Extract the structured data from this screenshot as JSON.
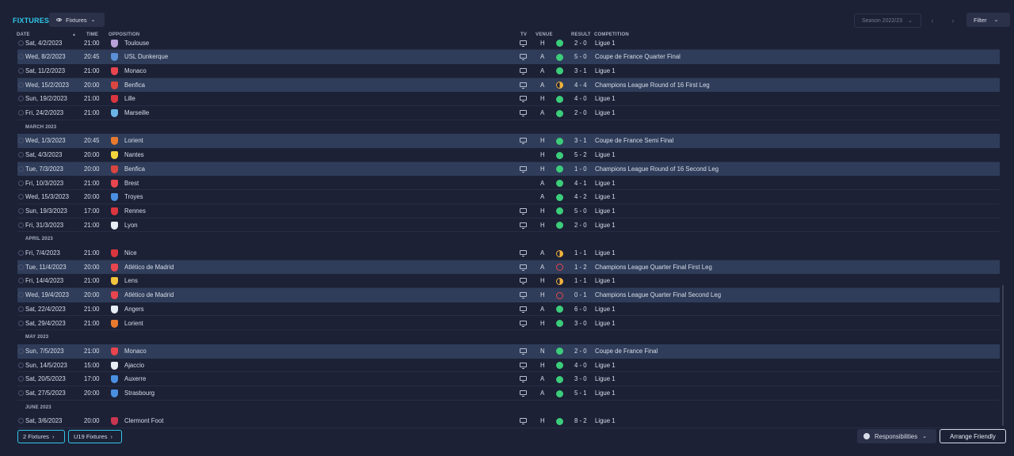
{
  "header": {
    "title": "FIXTURES",
    "view_label": "Fixtures",
    "season_label": "Season 2022/23",
    "filter_label": "Filter"
  },
  "columns": {
    "date": "DATE",
    "time": "TIME",
    "opposition": "OPPOSITION",
    "tv": "TV",
    "venue": "VENUE",
    "result": "RESULT",
    "competition": "COMPETITION"
  },
  "rows": [
    {
      "kind": "match",
      "date": "Sat, 4/2/2023",
      "time": "21:00",
      "opp": "Toulouse",
      "badge": "#b8a0d8",
      "tv": true,
      "venue": "H",
      "outcome": "win",
      "score": "2 - 0",
      "comp": "Ligue 1",
      "alt": false
    },
    {
      "kind": "match",
      "date": "Wed, 8/2/2023",
      "time": "20:45",
      "opp": "USL Dunkerque",
      "badge": "#5b8fd6",
      "tv": true,
      "venue": "A",
      "outcome": "win",
      "score": "5 - 0",
      "comp": "Coupe de France Quarter Final",
      "alt": true
    },
    {
      "kind": "match",
      "date": "Sat, 11/2/2023",
      "time": "21:00",
      "opp": "Monaco",
      "badge": "#e8454f",
      "tv": true,
      "venue": "A",
      "outcome": "win",
      "score": "3 - 1",
      "comp": "Ligue 1",
      "alt": false
    },
    {
      "kind": "match",
      "date": "Wed, 15/2/2023",
      "time": "20:00",
      "opp": "Benfica",
      "badge": "#d9463f",
      "tv": true,
      "venue": "A",
      "outcome": "draw",
      "score": "4 - 4",
      "comp": "Champions League Round of 16  First Leg",
      "alt": true
    },
    {
      "kind": "match",
      "date": "Sun, 19/2/2023",
      "time": "21:00",
      "opp": "Lille",
      "badge": "#d9363f",
      "tv": true,
      "venue": "H",
      "outcome": "win",
      "score": "4 - 0",
      "comp": "Ligue 1",
      "alt": false
    },
    {
      "kind": "match",
      "date": "Fri, 24/2/2023",
      "time": "21:00",
      "opp": "Marseille",
      "badge": "#6ab4e6",
      "tv": true,
      "venue": "A",
      "outcome": "win",
      "score": "2 - 0",
      "comp": "Ligue 1",
      "alt": false
    },
    {
      "kind": "month",
      "label": "MARCH 2023"
    },
    {
      "kind": "match",
      "date": "Wed, 1/3/2023",
      "time": "20:45",
      "opp": "Lorient",
      "badge": "#e87a2f",
      "tv": true,
      "venue": "H",
      "outcome": "win",
      "score": "3 - 1",
      "comp": "Coupe de France Semi Final",
      "alt": true
    },
    {
      "kind": "match",
      "date": "Sat, 4/3/2023",
      "time": "20:00",
      "opp": "Nantes",
      "badge": "#f2d43d",
      "tv": false,
      "venue": "H",
      "outcome": "win",
      "score": "5 - 2",
      "comp": "Ligue 1",
      "alt": false
    },
    {
      "kind": "match",
      "date": "Tue, 7/3/2023",
      "time": "20:00",
      "opp": "Benfica",
      "badge": "#d9463f",
      "tv": true,
      "venue": "H",
      "outcome": "win",
      "score": "1 - 0",
      "comp": "Champions League Round of 16  Second Leg",
      "alt": true
    },
    {
      "kind": "match",
      "date": "Fri, 10/3/2023",
      "time": "21:00",
      "opp": "Brest",
      "badge": "#e8454f",
      "tv": false,
      "venue": "A",
      "outcome": "win",
      "score": "4 - 1",
      "comp": "Ligue 1",
      "alt": false
    },
    {
      "kind": "match",
      "date": "Wed, 15/3/2023",
      "time": "20:00",
      "opp": "Troyes",
      "badge": "#4a8fe0",
      "tv": false,
      "venue": "A",
      "outcome": "win",
      "score": "4 - 2",
      "comp": "Ligue 1",
      "alt": false
    },
    {
      "kind": "match",
      "date": "Sun, 19/3/2023",
      "time": "17:00",
      "opp": "Rennes",
      "badge": "#d9363f",
      "tv": true,
      "venue": "H",
      "outcome": "win",
      "score": "5 - 0",
      "comp": "Ligue 1",
      "alt": false
    },
    {
      "kind": "match",
      "date": "Fri, 31/3/2023",
      "time": "21:00",
      "opp": "Lyon",
      "badge": "#e8ecf4",
      "tv": true,
      "venue": "H",
      "outcome": "win",
      "score": "2 - 0",
      "comp": "Ligue 1",
      "alt": false
    },
    {
      "kind": "month",
      "label": "APRIL 2023"
    },
    {
      "kind": "match",
      "date": "Fri, 7/4/2023",
      "time": "21:00",
      "opp": "Nice",
      "badge": "#d9363f",
      "tv": true,
      "venue": "A",
      "outcome": "draw",
      "score": "1 - 1",
      "comp": "Ligue 1",
      "alt": false
    },
    {
      "kind": "match",
      "date": "Tue, 11/4/2023",
      "time": "20:00",
      "opp": "Atlético de Madrid",
      "badge": "#e8454f",
      "tv": true,
      "venue": "A",
      "outcome": "loss",
      "score": "1 - 2",
      "comp": "Champions League Quarter Final First Leg",
      "alt": true
    },
    {
      "kind": "match",
      "date": "Fri, 14/4/2023",
      "time": "21:00",
      "opp": "Lens",
      "badge": "#f2c33d",
      "tv": true,
      "venue": "H",
      "outcome": "draw",
      "score": "1 - 1",
      "comp": "Ligue 1",
      "alt": false
    },
    {
      "kind": "match",
      "date": "Wed, 19/4/2023",
      "time": "20:00",
      "opp": "Atlético de Madrid",
      "badge": "#e8454f",
      "tv": true,
      "venue": "H",
      "outcome": "loss",
      "score": "0 - 1",
      "comp": "Champions League Quarter Final Second Leg",
      "alt": true
    },
    {
      "kind": "match",
      "date": "Sat, 22/4/2023",
      "time": "21:00",
      "opp": "Angers",
      "badge": "#e8ecf4",
      "tv": true,
      "venue": "A",
      "outcome": "win",
      "score": "6 - 0",
      "comp": "Ligue 1",
      "alt": false
    },
    {
      "kind": "match",
      "date": "Sat, 29/4/2023",
      "time": "21:00",
      "opp": "Lorient",
      "badge": "#e87a2f",
      "tv": true,
      "venue": "H",
      "outcome": "win",
      "score": "3 - 0",
      "comp": "Ligue 1",
      "alt": false
    },
    {
      "kind": "month",
      "label": "MAY 2023"
    },
    {
      "kind": "match",
      "date": "Sun, 7/5/2023",
      "time": "21:00",
      "opp": "Monaco",
      "badge": "#e8454f",
      "tv": true,
      "venue": "N",
      "outcome": "win",
      "score": "2 - 0",
      "comp": "Coupe de France Final",
      "alt": true
    },
    {
      "kind": "match",
      "date": "Sun, 14/5/2023",
      "time": "15:00",
      "opp": "Ajaccio",
      "badge": "#e8ecf4",
      "tv": true,
      "venue": "H",
      "outcome": "win",
      "score": "4 - 0",
      "comp": "Ligue 1",
      "alt": false
    },
    {
      "kind": "match",
      "date": "Sat, 20/5/2023",
      "time": "17:00",
      "opp": "Auxerre",
      "badge": "#4a8fe0",
      "tv": true,
      "venue": "A",
      "outcome": "win",
      "score": "3 - 0",
      "comp": "Ligue 1",
      "alt": false
    },
    {
      "kind": "match",
      "date": "Sat, 27/5/2023",
      "time": "20:00",
      "opp": "Strasbourg",
      "badge": "#4a8fe0",
      "tv": true,
      "venue": "A",
      "outcome": "win",
      "score": "5 - 1",
      "comp": "Ligue 1",
      "alt": false
    },
    {
      "kind": "month",
      "label": "JUNE 2023"
    },
    {
      "kind": "match",
      "date": "Sat, 3/6/2023",
      "time": "20:00",
      "opp": "Clermont Foot",
      "badge": "#c8364f",
      "tv": true,
      "venue": "H",
      "outcome": "win",
      "score": "8 - 2",
      "comp": "Ligue 1",
      "alt": false
    }
  ],
  "footer": {
    "fixtures_link": "2 Fixtures",
    "u19_link": "U19 Fixtures",
    "responsibilities_label": "Responsibilities",
    "arrange_label": "Arrange Friendly"
  },
  "colors": {
    "accent": "#2fc7e6",
    "win": "#3ccd7a",
    "draw": "#f2b33d",
    "loss": "#e8454f",
    "row_highlight": "#2f3d5a"
  }
}
